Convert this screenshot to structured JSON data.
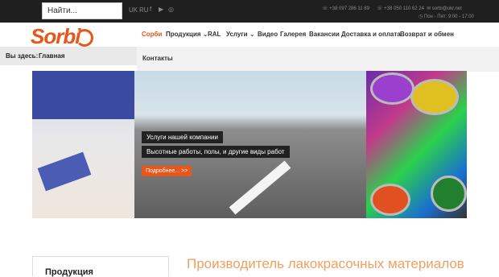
{
  "topbar": {
    "search_placeholder": "Найти...",
    "lang_uk": "UK",
    "lang_ru": "RU",
    "phone1": "+38 097 286 11 89",
    "phone2": "+38 050 110 62 24",
    "email": "sorbi@ukr.net",
    "hours": "Пон - Пят: 9:00 - 17:00"
  },
  "logo": {
    "text": "Sorbi"
  },
  "nav": {
    "items": [
      {
        "label": "Сорби",
        "active": true
      },
      {
        "label": "Продукция ⌄"
      },
      {
        "label": "RAL"
      },
      {
        "label": "Услуги ⌄"
      },
      {
        "label": "Видео"
      },
      {
        "label": "Галерея"
      },
      {
        "label": "Вакансии"
      },
      {
        "label": "Доставка и оплата"
      },
      {
        "label": "Возврат и обмен"
      }
    ],
    "row2": "Контакты"
  },
  "breadcrumb": {
    "label": "Вы здесь:",
    "current": "Главная"
  },
  "slider": {
    "caption1": "Услуги нашей компании",
    "caption2": "Высотные работы, полы, и другие виды работ",
    "more_button": "Подробнее... >>"
  },
  "sidebar": {
    "title": "Продукция"
  },
  "main": {
    "headline": "Производитель лакокрасочных материалов"
  },
  "colors": {
    "accent": "#e8561a",
    "topbar": "#1f1f1f"
  }
}
